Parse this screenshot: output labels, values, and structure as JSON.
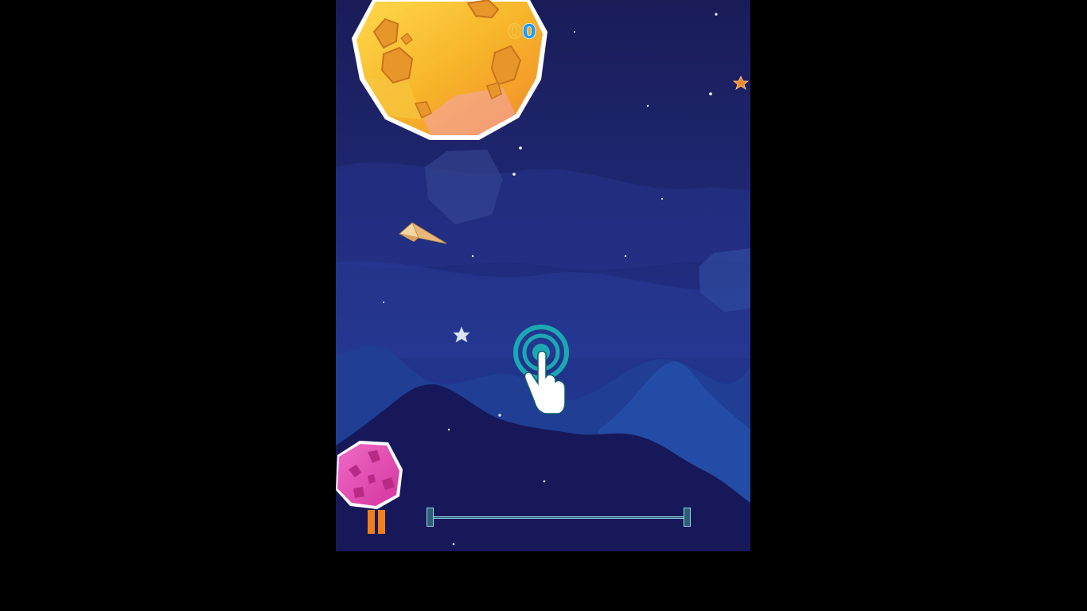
{
  "hud": {
    "best_score": "0",
    "current_score": "0",
    "pause_icon": "pause-icon",
    "level_progress": 0.0
  },
  "tutorial": {
    "hint_icon": "tap-gesture-icon"
  },
  "colors": {
    "background": "#000000",
    "sky_top": "#1b1f5e",
    "sky_bottom": "#2a3a8c",
    "mountain_light": "#1f3e94",
    "mountain_dark": "#17185a",
    "planet_orange": "#f7b52a",
    "planet_pink": "#e84ab2",
    "pause_orange": "#f2801a",
    "score_blue": "#1e9bff",
    "score_gold": "#f4c542",
    "tap_teal": "#1ba8b3",
    "track_blue": "#2f5e74"
  },
  "icons": {
    "player": "paper-plane-icon",
    "star": "star-icon",
    "orange_star": "orange-star-icon"
  }
}
